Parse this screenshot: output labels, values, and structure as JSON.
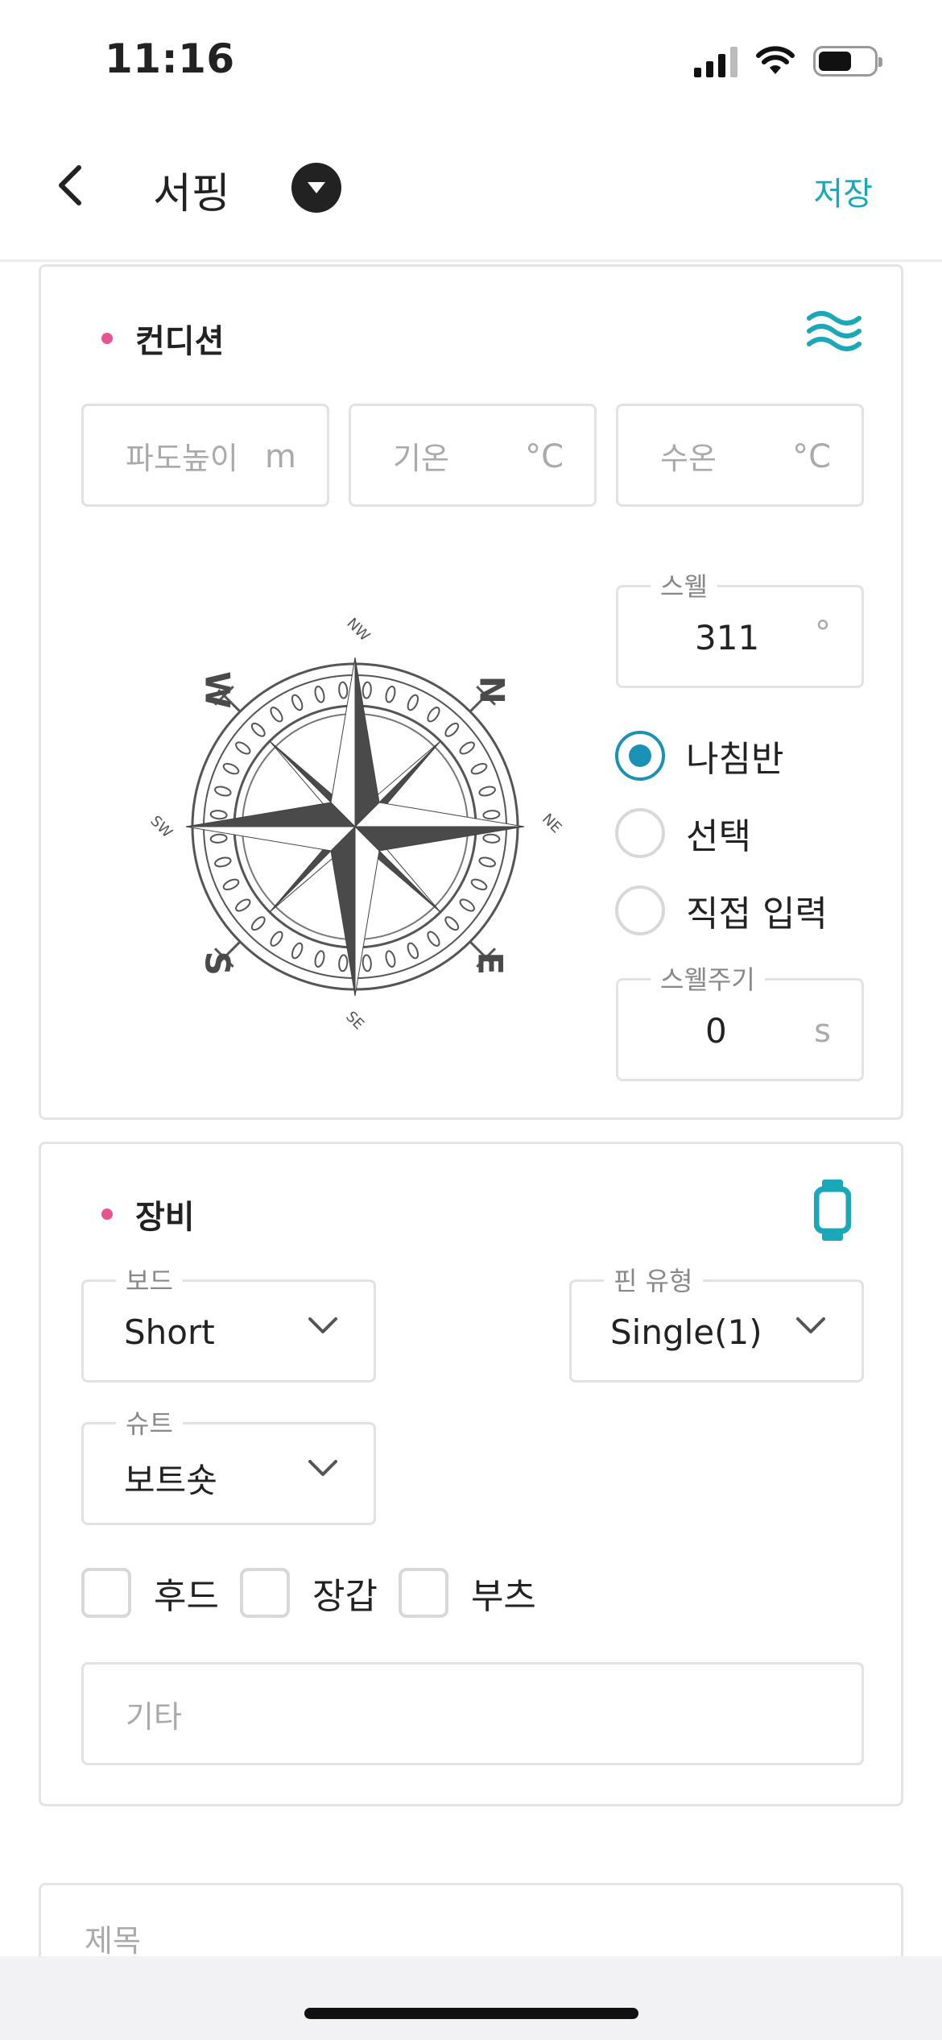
{
  "status": {
    "time": "11:16"
  },
  "nav": {
    "title": "서핑",
    "save": "저장"
  },
  "conditions": {
    "title": "컨디션",
    "wave_height": {
      "placeholder": "파도높이",
      "unit": "m"
    },
    "air_temp": {
      "placeholder": "기온",
      "unit": "°C"
    },
    "water_temp": {
      "placeholder": "수온",
      "unit": "°C"
    },
    "swell": {
      "label": "스웰",
      "value": "311",
      "unit": "°"
    },
    "swell_mode": {
      "options": [
        "나침반",
        "선택",
        "직접 입력"
      ],
      "selected": "나침반"
    },
    "swell_period": {
      "label": "스웰주기",
      "value": "0",
      "unit": "s"
    },
    "compass": {
      "letters": [
        "N",
        "E",
        "S",
        "W"
      ],
      "diagonals": [
        "NE",
        "SE",
        "SW",
        "NW"
      ]
    }
  },
  "equipment": {
    "title": "장비",
    "board": {
      "label": "보드",
      "value": "Short"
    },
    "fin": {
      "label": "핀 유형",
      "value": "Single(1)"
    },
    "suit": {
      "label": "슈트",
      "value": "보트숏"
    },
    "checks": [
      {
        "label": "후드",
        "checked": false
      },
      {
        "label": "장갑",
        "checked": false
      },
      {
        "label": "부츠",
        "checked": false
      }
    ],
    "etc": {
      "placeholder": "기타"
    }
  },
  "title_field": {
    "placeholder": "제목"
  },
  "colors": {
    "accent": "#1aa7b8",
    "radio": "#1a92b6",
    "dot": "#e7548f"
  }
}
